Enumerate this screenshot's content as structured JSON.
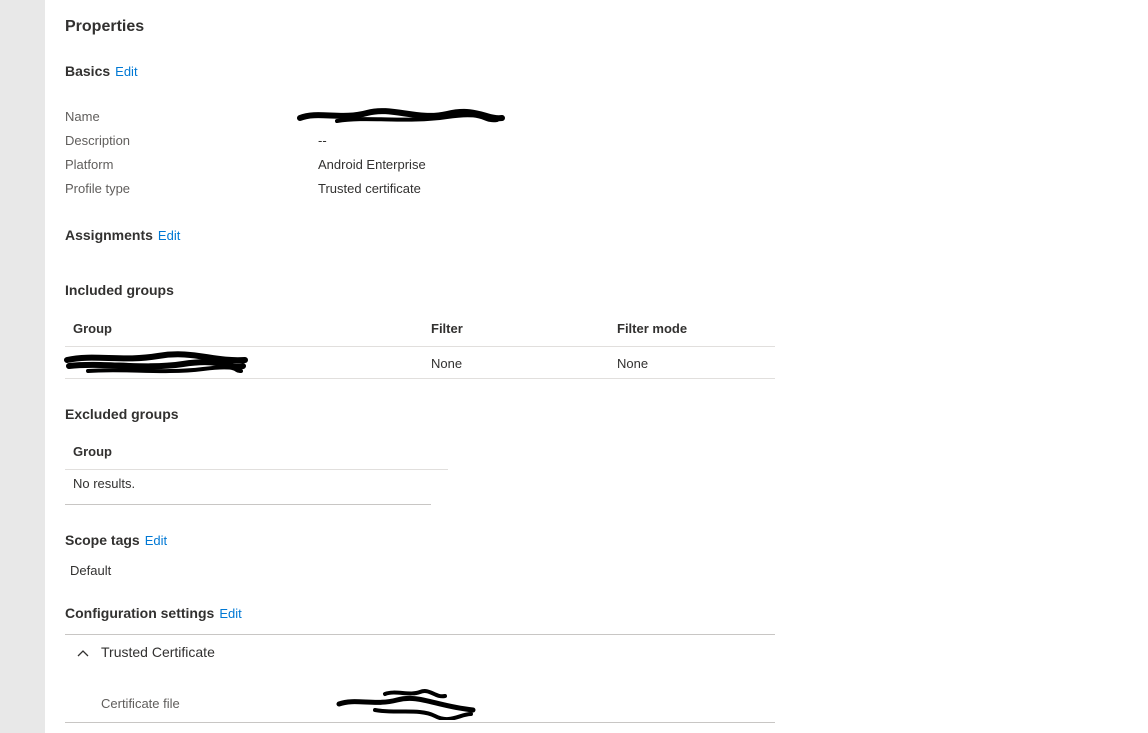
{
  "properties": {
    "title": "Properties",
    "edit_label": "Edit",
    "basics": {
      "title": "Basics",
      "rows": [
        {
          "label": "Name",
          "value": ""
        },
        {
          "label": "Description",
          "value": "--"
        },
        {
          "label": "Platform",
          "value": "Android Enterprise"
        },
        {
          "label": "Profile type",
          "value": "Trusted certificate"
        }
      ]
    },
    "assignments": {
      "title": "Assignments",
      "included": {
        "title": "Included groups",
        "columns": [
          "Group",
          "Filter",
          "Filter mode"
        ],
        "rows": [
          {
            "group": "",
            "filter": "None",
            "filter_mode": "None"
          }
        ]
      },
      "excluded": {
        "title": "Excluded groups",
        "columns": [
          "Group"
        ],
        "empty_text": "No results."
      }
    },
    "scope_tags": {
      "title": "Scope tags",
      "value": "Default"
    },
    "configuration": {
      "title": "Configuration settings",
      "section_title": "Trusted Certificate",
      "rows": [
        {
          "label": "Certificate file",
          "value": ""
        }
      ]
    }
  },
  "icons": {
    "collapse": "chevron-up-icon"
  },
  "colors": {
    "link": "#0078d4",
    "rail": "#e8e8e8",
    "text": "#323130",
    "label": "#605e5c"
  }
}
